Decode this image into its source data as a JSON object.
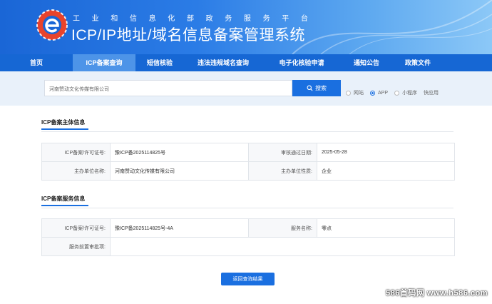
{
  "header": {
    "subtitle_chars": [
      "工",
      "业",
      "和",
      "信",
      "息",
      "化",
      "部",
      "政",
      "务",
      "服",
      "务",
      "平",
      "台"
    ],
    "title": "ICP/IP地址/域名信息备案管理系统",
    "logo_icon": "miit-logo-icon",
    "colors": {
      "primary": "#1a66d6",
      "nav": "#1667d4",
      "nav_active": "#4d94e8",
      "logo_red": "#e8432b"
    }
  },
  "nav": {
    "items": [
      {
        "label": "首页",
        "active": false
      },
      {
        "label": "ICP备案查询",
        "active": true
      },
      {
        "label": "短信核验",
        "active": false
      },
      {
        "label": "违法违规域名查询",
        "active": false
      },
      {
        "label": "电子化核验申请",
        "active": false
      },
      {
        "label": "通知公告",
        "active": false
      },
      {
        "label": "政策文件",
        "active": false
      }
    ]
  },
  "search": {
    "value": "河南赞动文化传媒有限公司",
    "button_label": "搜索",
    "button_icon": "search-icon",
    "options": [
      {
        "label": "网站",
        "selected": false
      },
      {
        "label": "APP",
        "selected": true
      },
      {
        "label": "小程序",
        "selected": false
      },
      {
        "label": "快应用",
        "selected": false
      }
    ]
  },
  "subject": {
    "title": "ICP备案主体信息",
    "rows": [
      {
        "label1": "ICP备案/许可证号:",
        "value1": "豫ICP备2025114825号",
        "label2": "审核通过日期:",
        "value2": "2025-05-28"
      },
      {
        "label1": "主办单位名称:",
        "value1": "河南赞动文化传媒有限公司",
        "label2": "主办单位性质:",
        "value2": "企业"
      }
    ]
  },
  "service": {
    "title": "ICP备案服务信息",
    "row1": {
      "label1": "ICP备案/许可证号:",
      "value1": "豫ICP备2025114825号-4A",
      "label2": "服务名称:",
      "value2": "零点"
    },
    "row2": {
      "label": "服务前置审批项:",
      "value": ""
    }
  },
  "back_button": "返回查询结果",
  "watermark": "586首码网 www.h586.com"
}
